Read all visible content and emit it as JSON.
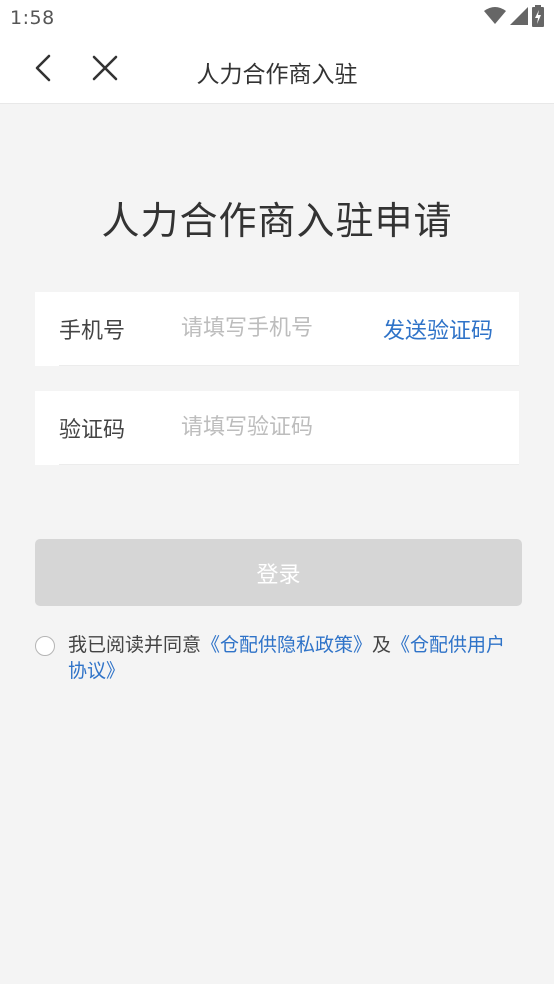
{
  "status_bar": {
    "time": "1:58",
    "icons": [
      "wifi-icon",
      "cellular-signal-icon",
      "battery-charging-icon"
    ]
  },
  "nav": {
    "title": "人力合作商入驻",
    "back_icon": "chevron-left-icon",
    "close_icon": "close-icon"
  },
  "page": {
    "heading": "人力合作商入驻申请"
  },
  "form": {
    "phone": {
      "label": "手机号",
      "placeholder": "请填写手机号",
      "value": "",
      "send_code_label": "发送验证码"
    },
    "code": {
      "label": "验证码",
      "placeholder": "请填写验证码",
      "value": ""
    }
  },
  "login_button": {
    "label": "登录",
    "enabled": false
  },
  "agreement": {
    "checked": false,
    "prefix": "我已阅读并同意",
    "privacy_link": "《仓配供隐私政策》",
    "conjunction": "及",
    "user_agreement_link": "《仓配供用户协议》"
  },
  "colors": {
    "link": "#2f73c8",
    "background": "#f4f4f4",
    "button_disabled": "#d6d6d6"
  }
}
